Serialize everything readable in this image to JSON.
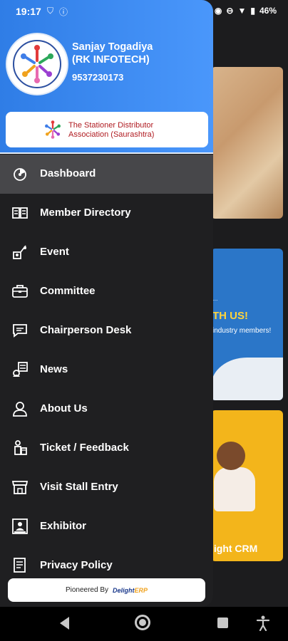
{
  "status": {
    "time": "19:17",
    "battery": "46%"
  },
  "user": {
    "name": "Sanjay Togadiya",
    "company": "(RK INFOTECH)",
    "phone": "9537230173"
  },
  "association": {
    "line1": "The Stationer Distributor",
    "line2": "Association (Saurashtra)"
  },
  "menu": [
    {
      "label": "Dashboard",
      "icon": "dashboard-icon",
      "active": true
    },
    {
      "label": "Member Directory",
      "icon": "directory-icon"
    },
    {
      "label": "Event",
      "icon": "event-icon"
    },
    {
      "label": "Committee",
      "icon": "briefcase-icon"
    },
    {
      "label": "Chairperson Desk",
      "icon": "chat-icon"
    },
    {
      "label": "News",
      "icon": "news-icon"
    },
    {
      "label": "About Us",
      "icon": "person-icon"
    },
    {
      "label": "Ticket / Feedback",
      "icon": "feedback-icon"
    },
    {
      "label": "Visit Stall Entry",
      "icon": "store-icon"
    },
    {
      "label": "Exhibitor",
      "icon": "exhibitor-icon"
    },
    {
      "label": "Privacy Policy",
      "icon": "policy-icon"
    }
  ],
  "footer": {
    "text": "Pioneered By",
    "brand_a": "Delight",
    "brand_b": "ERP"
  },
  "background_cards": {
    "card2_small": "...",
    "card2_title": "TH US!",
    "card2_sub": "industry members!",
    "card3_title": "light CRM"
  },
  "colors": {
    "header_start": "#2f7de6",
    "header_end": "#4a97fb",
    "drawer_bg": "#1f1f21",
    "active_item": "#47474a"
  }
}
